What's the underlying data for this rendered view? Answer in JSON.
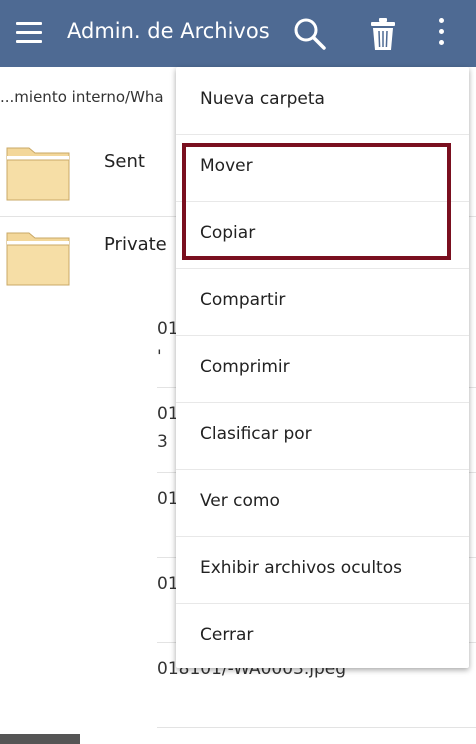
{
  "appbar": {
    "title": "Admin. de Archivos",
    "menu_icon": "hamburger-menu-icon",
    "search_icon": "search-icon",
    "trash_icon": "trash-icon",
    "more_icon": "more-vert-icon",
    "color": "#4e6a93"
  },
  "path": "...miento interno/Wha",
  "folders": [
    {
      "name": "Sent",
      "icon": "folder-icon"
    },
    {
      "name": "Private",
      "icon": "folder-icon"
    }
  ],
  "files_partial": [
    {
      "line1": "01",
      "line2": "'"
    },
    {
      "line1": "01",
      "line2": "3"
    },
    {
      "line1": "01",
      "line2": ""
    },
    {
      "line1": "01",
      "line2": ""
    },
    {
      "line1": "018101/-WA0003.jpeg",
      "line2": ""
    }
  ],
  "menu": {
    "items": [
      "Nueva carpeta",
      "Mover",
      "Copiar",
      "Compartir",
      "Comprimir",
      "Clasificar por",
      "Ver como",
      "Exhibir archivos ocultos",
      "Cerrar"
    ],
    "highlight_color": "#7a0f1f"
  }
}
